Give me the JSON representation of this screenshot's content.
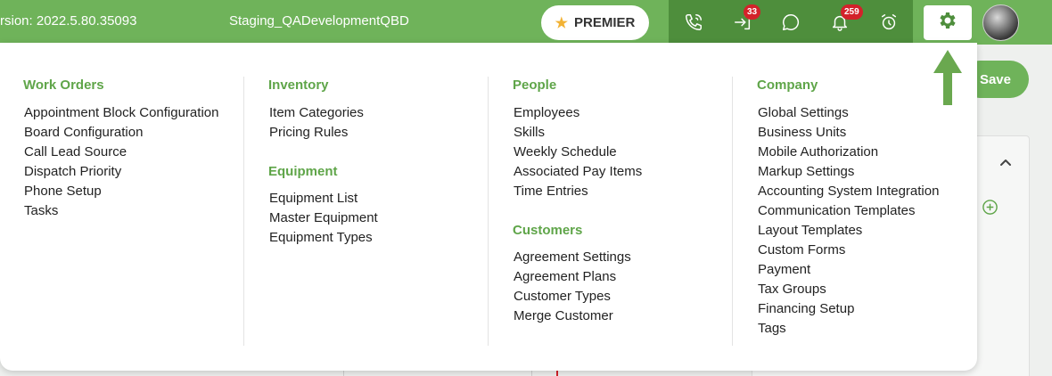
{
  "topbar": {
    "version": "rsion: 2022.5.80.35093",
    "environment": "Staging_QADevelopmentQBD",
    "premier_label": "PREMIER",
    "transfer_badge": "33",
    "notification_badge": "259"
  },
  "page": {
    "save_label": "Save"
  },
  "menu": {
    "work_orders": {
      "heading": "Work Orders",
      "items": [
        "Appointment Block Configuration",
        "Board Configuration",
        "Call Lead Source",
        "Dispatch Priority",
        "Phone Setup",
        "Tasks"
      ]
    },
    "inventory": {
      "heading": "Inventory",
      "items": [
        "Item Categories",
        "Pricing Rules"
      ]
    },
    "equipment": {
      "heading": "Equipment",
      "items": [
        "Equipment List",
        "Master Equipment",
        "Equipment Types"
      ]
    },
    "people": {
      "heading": "People",
      "items": [
        "Employees",
        "Skills",
        "Weekly Schedule",
        "Associated Pay Items",
        "Time Entries"
      ]
    },
    "customers": {
      "heading": "Customers",
      "items": [
        "Agreement Settings",
        "Agreement Plans",
        "Customer Types",
        "Merge Customer"
      ]
    },
    "company": {
      "heading": "Company",
      "items": [
        "Global Settings",
        "Business Units",
        "Mobile Authorization",
        "Markup Settings",
        "Accounting System Integration",
        "Communication Templates",
        "Layout Templates",
        "Custom Forms",
        "Payment",
        "Tax Groups",
        "Financing Setup",
        "Tags"
      ]
    }
  },
  "icons": {
    "topbar": [
      "phone-icon",
      "transfer-icon",
      "chat-icon",
      "bell-icon",
      "alarm-clock-icon",
      "gear-icon"
    ],
    "page": [
      "chevron-up-icon",
      "add-circle-icon"
    ],
    "annotation": "arrow-up-icon"
  },
  "colors": {
    "brand_green": "#6fb35a",
    "dark_green": "#4e8e3c",
    "heading_green": "#5fa549",
    "badge_red": "#d3222a",
    "star_gold": "#f2b234"
  }
}
